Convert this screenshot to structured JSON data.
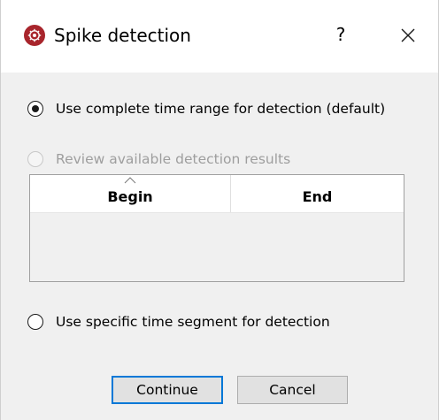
{
  "dialog": {
    "title": "Spike detection",
    "help_label": "?",
    "app_icon": "spike-app-icon",
    "close_icon": "close-icon"
  },
  "options": {
    "complete_range": {
      "label": "Use complete time range for detection (default)",
      "checked": true,
      "enabled": true
    },
    "review_results": {
      "label": "Review available detection results",
      "checked": false,
      "enabled": false
    },
    "specific_segment": {
      "label": "Use specific time segment for detection",
      "checked": false,
      "enabled": true
    }
  },
  "table": {
    "columns": [
      "Begin",
      "End"
    ],
    "sort_column": "Begin",
    "rows": []
  },
  "buttons": {
    "continue_label": "Continue",
    "cancel_label": "Cancel"
  },
  "colors": {
    "accent": "#0078d7",
    "app_icon": "#a8252c"
  }
}
